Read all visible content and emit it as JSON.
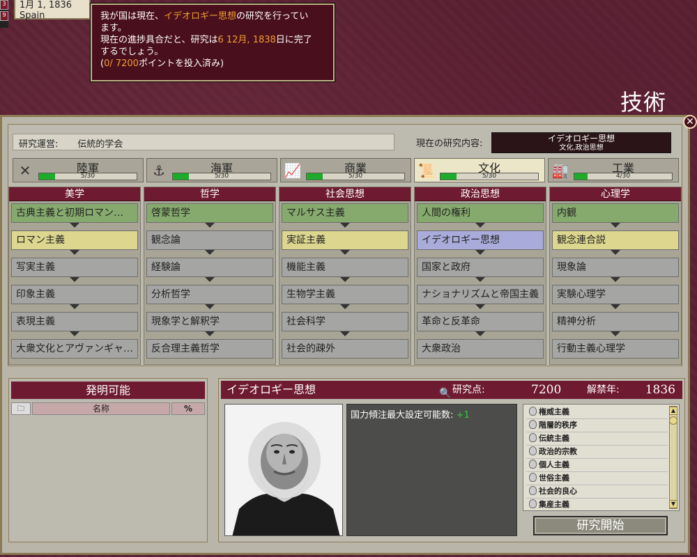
{
  "date": {
    "text": "1月 1, 1836",
    "country": "Spain"
  },
  "tooltip": {
    "line1_pre": "我が国は現在、",
    "line1_hl": "イデオロギー思想",
    "line1_post": "の研究を行ってい",
    "line2": "ます。",
    "line3_pre": "現在の進捗具合だと、研究は",
    "line3_hl": "6  12月, 1838",
    "line3_post": "日に完了",
    "line4": "するでしょう。",
    "line5_pre": "(",
    "line5_hl": "0/ 7200",
    "line5_post": "ポイントを投入済み)"
  },
  "page_title": "技術",
  "close_label": "✕",
  "management": {
    "label": "研究運営:",
    "value": "伝統的学会"
  },
  "current_research": {
    "label": "現在の研究内容:",
    "name": "イデオロギー思想",
    "category": "文化,政治思想"
  },
  "categories": [
    {
      "name": "陸軍",
      "count": "5/30",
      "progress": 0.167,
      "icon": "crossed-swords-icon",
      "glyph": "✕",
      "active": false
    },
    {
      "name": "海軍",
      "count": "5/30",
      "progress": 0.167,
      "icon": "anchor-icon",
      "glyph": "⚓",
      "active": false
    },
    {
      "name": "商業",
      "count": "5/30",
      "progress": 0.167,
      "icon": "chart-icon",
      "glyph": "📈",
      "active": false
    },
    {
      "name": "文化",
      "count": "5/30",
      "progress": 0.167,
      "icon": "book-icon",
      "glyph": "📜",
      "active": true
    },
    {
      "name": "工業",
      "count": "4/30",
      "progress": 0.133,
      "icon": "factory-icon",
      "glyph": "🏭",
      "active": false
    }
  ],
  "columns": [
    {
      "title": "美学",
      "techs": [
        {
          "name": "古典主義と初期ロマン…",
          "state": "done"
        },
        {
          "name": "ロマン主義",
          "state": "yellow"
        },
        {
          "name": "写実主義",
          "state": "none"
        },
        {
          "name": "印象主義",
          "state": "none"
        },
        {
          "name": "表現主義",
          "state": "none"
        },
        {
          "name": "大衆文化とアヴァンギャ…",
          "state": "none"
        }
      ]
    },
    {
      "title": "哲学",
      "techs": [
        {
          "name": "啓蒙哲学",
          "state": "done"
        },
        {
          "name": "観念論",
          "state": "none"
        },
        {
          "name": "経験論",
          "state": "none"
        },
        {
          "name": "分析哲学",
          "state": "none"
        },
        {
          "name": "現象学と解釈学",
          "state": "none"
        },
        {
          "name": "反合理主義哲学",
          "state": "none"
        }
      ]
    },
    {
      "title": "社会思想",
      "techs": [
        {
          "name": "マルサス主義",
          "state": "done"
        },
        {
          "name": "実証主義",
          "state": "yellow"
        },
        {
          "name": "機能主義",
          "state": "none"
        },
        {
          "name": "生物学主義",
          "state": "none"
        },
        {
          "name": "社会科学",
          "state": "none"
        },
        {
          "name": "社会的疎外",
          "state": "none"
        }
      ]
    },
    {
      "title": "政治思想",
      "techs": [
        {
          "name": "人間の権利",
          "state": "done"
        },
        {
          "name": "イデオロギー思想",
          "state": "blue"
        },
        {
          "name": "国家と政府",
          "state": "none"
        },
        {
          "name": "ナショナリズムと帝国主義",
          "state": "none"
        },
        {
          "name": "革命と反革命",
          "state": "none"
        },
        {
          "name": "大衆政治",
          "state": "none"
        }
      ]
    },
    {
      "title": "心理学",
      "techs": [
        {
          "name": "内観",
          "state": "done"
        },
        {
          "name": "観念連合説",
          "state": "yellow"
        },
        {
          "name": "現象論",
          "state": "none"
        },
        {
          "name": "実験心理学",
          "state": "none"
        },
        {
          "name": "精神分析",
          "state": "none"
        },
        {
          "name": "行動主義心理学",
          "state": "none"
        }
      ]
    }
  ],
  "inventions": {
    "title": "発明可能",
    "name_header": "名称",
    "pct_header": "%"
  },
  "detail": {
    "title": "イデオロギー思想",
    "rp_label": "研究点:",
    "rp_value": "7200",
    "year_label": "解禁年:",
    "year_value": "1836",
    "effect_text": "国力傾注最大設定可能数:",
    "effect_value": "+1",
    "ideologies": [
      "権威主義",
      "階層的秩序",
      "伝統主義",
      "政治的宗教",
      "個人主義",
      "世俗主義",
      "社会的良心",
      "集産主義"
    ],
    "start_button": "研究開始"
  },
  "colors": {
    "done": "#86aa6d",
    "yellow": "#dcd68f",
    "blue": "#a9acda",
    "header": "#6e1a30",
    "progress": "#1eaa2a"
  }
}
